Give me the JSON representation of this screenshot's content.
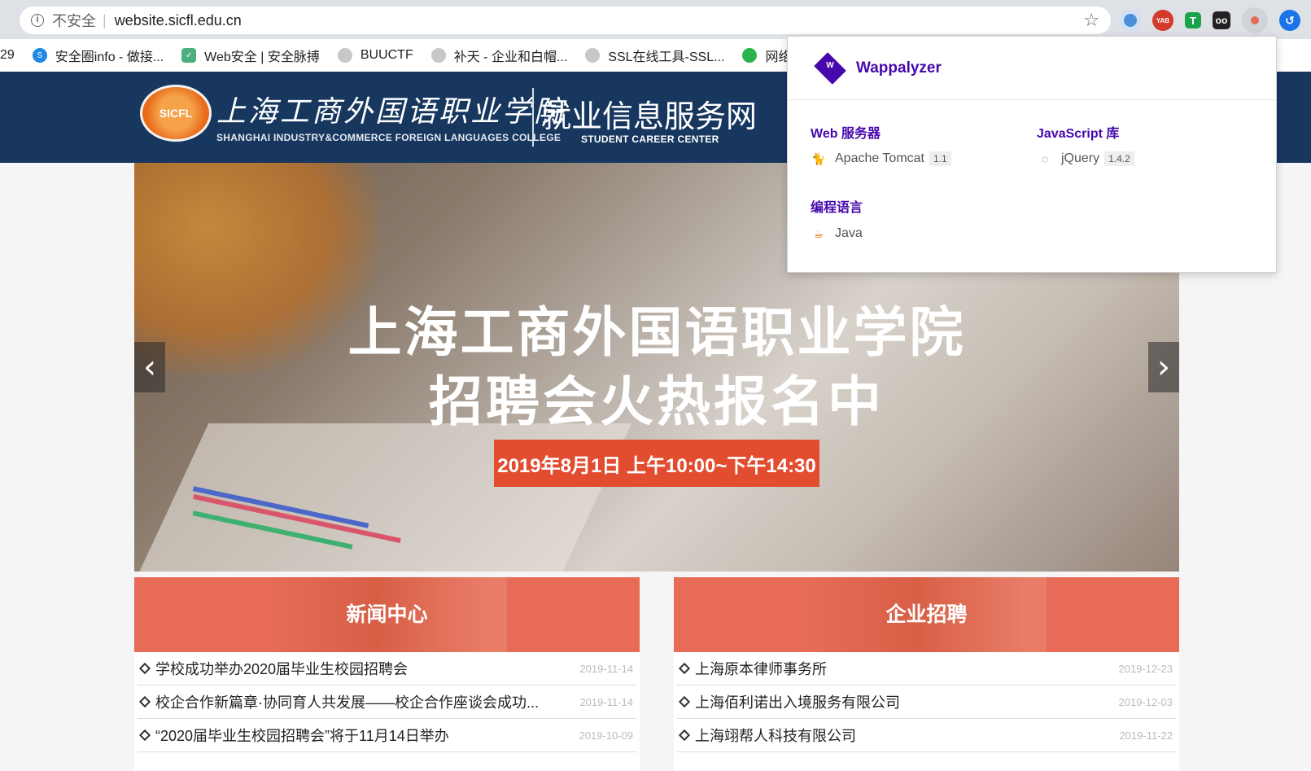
{
  "browser": {
    "insecure_label": "不安全",
    "separator": "|",
    "url": "website.sicfl.edu.cn"
  },
  "bookmarks": [
    {
      "label": "29",
      "icon": "truncated"
    },
    {
      "label": "安全圈info - 做接...",
      "icon": "swirl-blue-icon"
    },
    {
      "label": "Web安全 | 安全脉搏",
      "icon": "shield-icon"
    },
    {
      "label": "BUUCTF",
      "icon": "globe-icon"
    },
    {
      "label": "补天 - 企业和白帽...",
      "icon": "globe-icon"
    },
    {
      "label": "SSL在线工具-SSL...",
      "icon": "globe-icon"
    },
    {
      "label": "网络",
      "icon": "green-hex-icon"
    }
  ],
  "site": {
    "logo_badge": "SICFL",
    "name_cn": "上海工商外国语职业学院",
    "name_en": "SHANGHAI INDUSTRY&COMMERCE FOREIGN LANGUAGES COLLEGE",
    "section_cn": "就业信息服务网",
    "section_en": "STUDENT CAREER CENTER"
  },
  "banner": {
    "title_line1": "上海工商外国语职业学院",
    "title_line2": "招聘会火热报名中",
    "date_text": "2019年8月1日  上午10:00~下午14:30",
    "prev_arrow": "‹",
    "next_arrow": "›"
  },
  "news": {
    "title": "新闻中心",
    "items": [
      {
        "text": "学校成功举办2020届毕业生校园招聘会",
        "date": "2019-11-14"
      },
      {
        "text": "校企合作新篇章·协同育人共发展——校企合作座谈会成功...",
        "date": "2019-11-14"
      },
      {
        "text": "“2020届毕业生校园招聘会”将于11月14日举办",
        "date": "2019-10-09"
      }
    ]
  },
  "jobs": {
    "title": "企业招聘",
    "items": [
      {
        "text": "上海原本律师事务所",
        "date": "2019-12-23"
      },
      {
        "text": "上海佰利诺出入境服务有限公司",
        "date": "2019-12-03"
      },
      {
        "text": "上海翊帮人科技有限公司",
        "date": "2019-11-22"
      }
    ]
  },
  "wappalyzer": {
    "name": "Wappalyzer",
    "logo_letter": "W",
    "categories": [
      {
        "title": "Web 服务器",
        "tech": "Apache Tomcat",
        "version": "1.1",
        "icon": "tomcat-cat-icon"
      },
      {
        "title": "JavaScript 库",
        "tech": "jQuery",
        "version": "1.4.2",
        "icon": "jquery-icon"
      },
      {
        "title": "编程语言",
        "tech": "Java",
        "version": "",
        "icon": "java-cup-icon"
      }
    ]
  },
  "extensions": {
    "yab_label": "YAB",
    "t_label": "T",
    "glasses_label": "oo",
    "history_label": "↺"
  },
  "colors": {
    "header_bg": "#17375f",
    "section_head": "#e76b56",
    "date_badge": "#e24c2f",
    "wappalyzer_purple": "#4608ad"
  }
}
